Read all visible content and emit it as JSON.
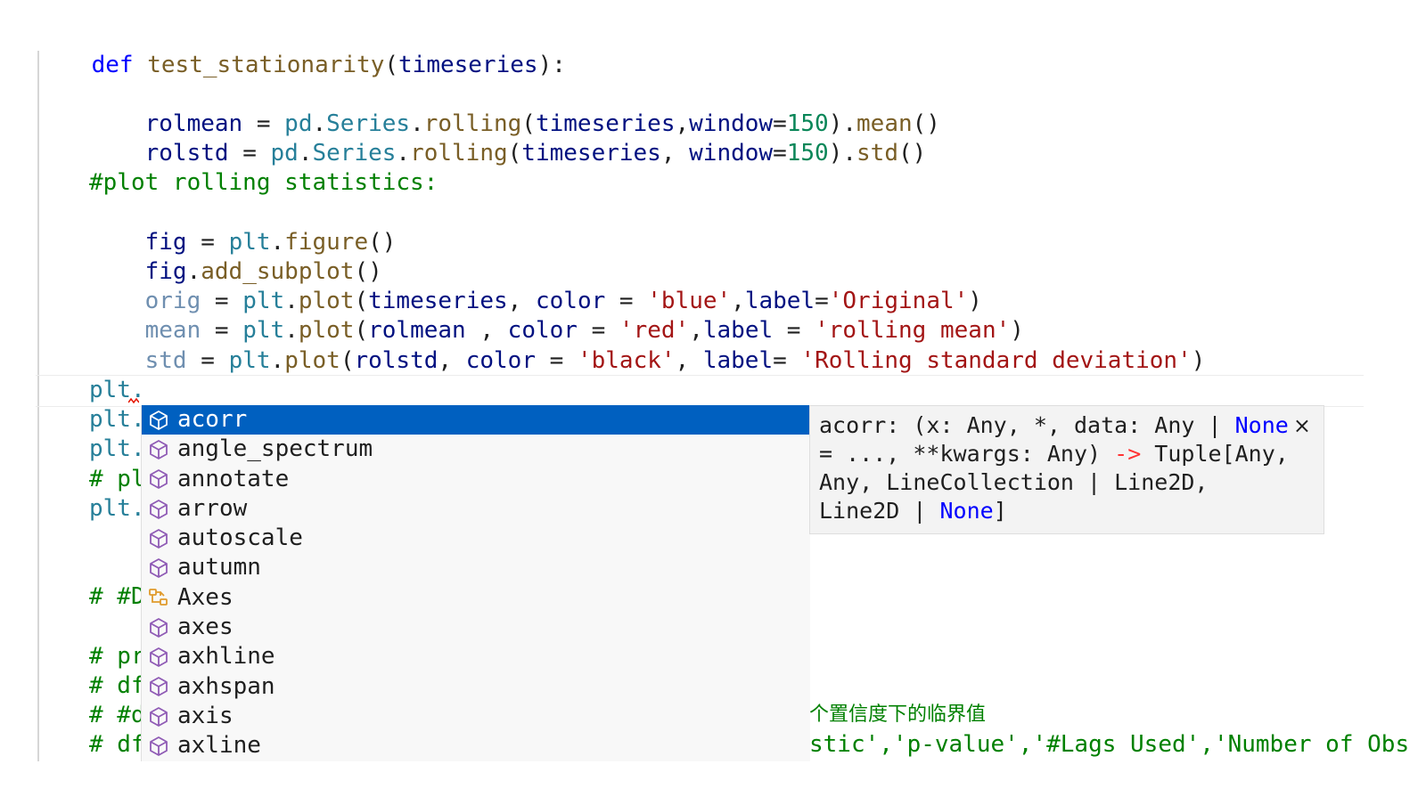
{
  "code": {
    "def_line": {
      "kw": "def",
      "fn": "test_stationarity",
      "open": "(",
      "param": "timeseries",
      "close": "):"
    },
    "rolmean_line": {
      "var": "rolmean",
      "eq": " = ",
      "mod": "pd",
      "dot1": ".",
      "cls": "Series",
      "dot2": ".",
      "fn": "rolling",
      "p1": "(",
      "arg1": "timeseries",
      "comma": ",",
      "kw": "window",
      "eq2": "=",
      "num": "150",
      "p2": ").",
      "fn2": "mean",
      "p3": "()"
    },
    "rolstd_line": {
      "var": "rolstd",
      "eq": " = ",
      "mod": "pd",
      "dot1": ".",
      "cls": "Series",
      "dot2": ".",
      "fn": "rolling",
      "p1": "(",
      "arg1": "timeseries",
      "comma": ", ",
      "kw": "window",
      "eq2": "=",
      "num": "150",
      "p2": ").",
      "fn2": "std",
      "p3": "()"
    },
    "comment_plot": "#plot rolling statistics:",
    "fig_line": {
      "var": "fig",
      "eq": " = ",
      "mod": "plt",
      "dot": ".",
      "fn": "figure",
      "p": "()"
    },
    "addsub_line": {
      "var": "fig",
      "dot": ".",
      "fn": "add_subplot",
      "p": "()"
    },
    "orig_line": {
      "var": "orig",
      "eq": " = ",
      "mod": "plt",
      "dot": ".",
      "fn": "plot",
      "p1": "(",
      "arg": "timeseries",
      "c1": ", ",
      "kw1": "color",
      "eq1": " = ",
      "s1": "'blue'",
      "c2": ",",
      "kw2": "label",
      "eq2": "=",
      "s2": "'Original'",
      "p2": ")"
    },
    "mean_line": {
      "var": "mean",
      "eq": " = ",
      "mod": "plt",
      "dot": ".",
      "fn": "plot",
      "p1": "(",
      "arg": "rolmean",
      "c1": " , ",
      "kw1": "color",
      "eq1": " = ",
      "s1": "'red'",
      "c2": ",",
      "kw2": "label",
      "eq2": " = ",
      "s2": "'rolling mean'",
      "p2": ")"
    },
    "std_line": {
      "var": "std",
      "eq": " = ",
      "mod": "plt",
      "dot": ".",
      "fn": "plot",
      "p1": "(",
      "arg": "rolstd",
      "c1": ", ",
      "kw1": "color",
      "eq1": " = ",
      "s1": "'black'",
      "c2": ", ",
      "kw2": "label",
      "eq2": "= ",
      "s2": "'Rolling standard deviation'",
      "p2": ")"
    },
    "cursor_line": "plt.",
    "hidden_lines": [
      "plt.",
      "plt.",
      "# pl",
      "plt."
    ],
    "hidden_comments": [
      "# #D",
      "# pr",
      "# df",
      "# #d",
      "# df"
    ],
    "tail_chinese": "个置信度下的临界值",
    "tail_code": "stic','p-value','#Lags Used','Number of Obs"
  },
  "suggest": {
    "items": [
      {
        "label": "acorr",
        "icon": "method-cube-icon",
        "selected": true
      },
      {
        "label": "angle_spectrum",
        "icon": "method-cube-icon"
      },
      {
        "label": "annotate",
        "icon": "method-cube-icon"
      },
      {
        "label": "arrow",
        "icon": "method-cube-icon"
      },
      {
        "label": "autoscale",
        "icon": "method-cube-icon"
      },
      {
        "label": "autumn",
        "icon": "method-cube-icon"
      },
      {
        "label": "Axes",
        "icon": "class-icon"
      },
      {
        "label": "axes",
        "icon": "method-cube-icon"
      },
      {
        "label": "axhline",
        "icon": "method-cube-icon"
      },
      {
        "label": "axhspan",
        "icon": "method-cube-icon"
      },
      {
        "label": "axis",
        "icon": "method-cube-icon"
      },
      {
        "label": "axline",
        "icon": "method-cube-icon"
      }
    ]
  },
  "doc": {
    "l1a": "acorr: (x: Any, *, data: Any | ",
    "l1none": "None",
    "l2a": "= ..., **kwargs: Any) ",
    "l2arrow": "->",
    "l2b": " Tuple[Any,",
    "l3": "Any, LineCollection | Line2D,",
    "l4a": "Line2D | ",
    "l4none": "None",
    "l4b": "]",
    "close": "×"
  },
  "colors": {
    "selection": "#0060c0",
    "keyword": "#0000ff",
    "string": "#a31515",
    "comment": "#008000",
    "icon_purple": "#8f5bb5",
    "icon_orange": "#e09a2b"
  }
}
